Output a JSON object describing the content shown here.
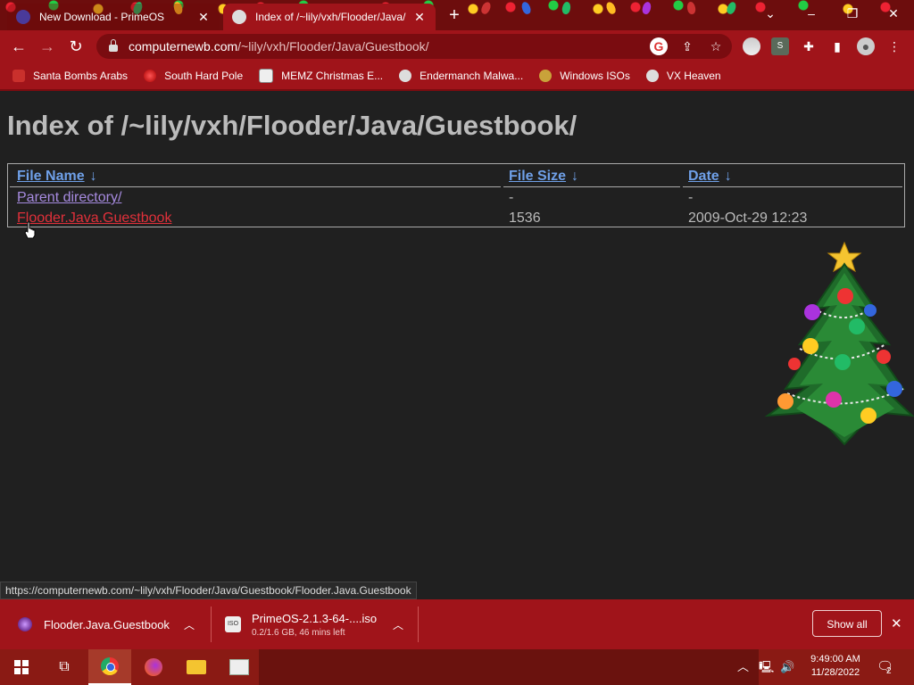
{
  "browser": {
    "tabs": [
      {
        "title": "New Download - PrimeOS",
        "active": false
      },
      {
        "title": "Index of /~lily/vxh/Flooder/Java/",
        "active": true
      }
    ],
    "url_domain": "computernewb.com",
    "url_path": "/~lily/vxh/Flooder/Java/Guestbook/",
    "bookmarks": [
      {
        "label": "Santa Bombs Arabs",
        "icon": "santa-icon"
      },
      {
        "label": "South Hard Pole",
        "icon": "star-burst-icon"
      },
      {
        "label": "MEMZ Christmas E...",
        "icon": "memz-icon"
      },
      {
        "label": "Endermanch Malwa...",
        "icon": "skull-icon"
      },
      {
        "label": "Windows ISOs",
        "icon": "gold-figure-icon"
      },
      {
        "label": "VX Heaven",
        "icon": "vx-icon"
      }
    ]
  },
  "page": {
    "title": "Index of /~lily/vxh/Flooder/Java/Guestbook/",
    "columns": {
      "name": "File Name",
      "size": "File Size",
      "date": "Date",
      "sort_arrow": "↓"
    },
    "rows": [
      {
        "name": "Parent directory/",
        "size": "-",
        "date": "-"
      },
      {
        "name": "Flooder.Java.Guestbook",
        "size": "1536",
        "date": "2009-Oct-29 12:23"
      }
    ]
  },
  "status_url": "https://computernewb.com/~lily/vxh/Flooder/Java/Guestbook/Flooder.Java.Guestbook",
  "downloads": {
    "items": [
      {
        "name": "Flooder.Java.Guestbook",
        "sub": ""
      },
      {
        "name": "PrimeOS-2.1.3-64-....iso",
        "sub": "0.2/1.6 GB, 46 mins left"
      }
    ],
    "show_all": "Show all"
  },
  "taskbar": {
    "time": "9:49:00 AM",
    "date": "11/28/2022",
    "notification_count": "2"
  },
  "colors": {
    "chrome_red": "#a0141a",
    "link_blue": "#6fa0e8",
    "link_visited": "#a78be0",
    "link_hover": "#e0303a"
  }
}
